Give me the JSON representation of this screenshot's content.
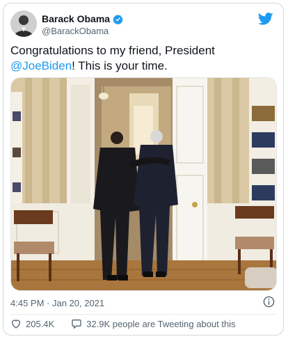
{
  "author": {
    "display_name": "Barack Obama",
    "handle": "@BarackObama",
    "verified_icon": "verified-badge-icon",
    "avatar_icon": "avatar"
  },
  "brand": {
    "icon": "twitter-bird-icon",
    "color": "#1d9bf0"
  },
  "tweet": {
    "text_before": "Congratulations to my friend, President ",
    "mention": "@JoeBiden",
    "text_after": "! This is your time.",
    "media": "photo"
  },
  "meta": {
    "timestamp": "4:45 PM · Jan 20, 2021",
    "info_icon": "info-icon"
  },
  "actions": {
    "likes": "205.4K",
    "retweets_label": "32.9K people are Tweeting about this",
    "like_icon": "heart-icon",
    "comment_icon": "comment-icon"
  },
  "colors": {
    "text": "#0f1419",
    "secondary": "#536471",
    "link": "#1d9bf0",
    "border": "#cfd9de"
  }
}
